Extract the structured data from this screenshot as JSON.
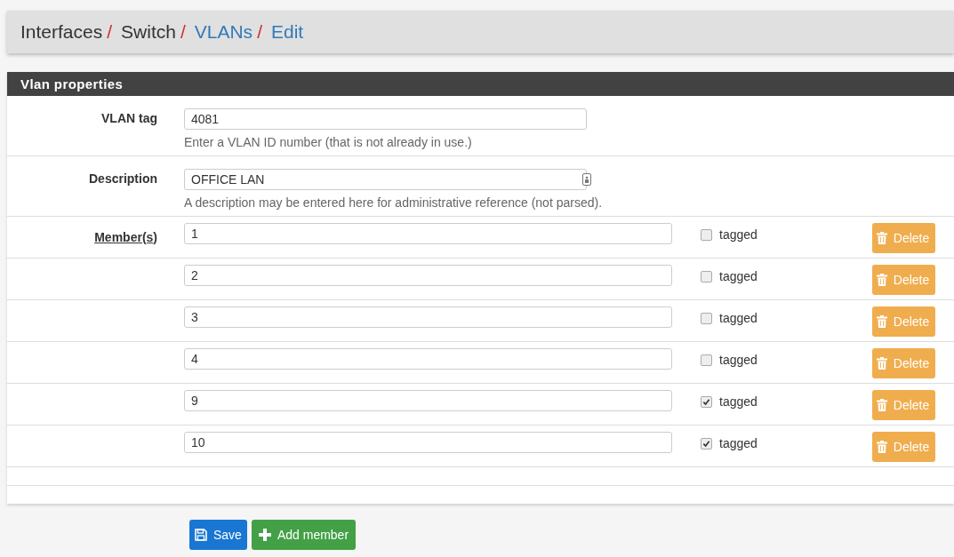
{
  "breadcrumb": [
    {
      "label": "Interfaces",
      "link": false,
      "separator": "/"
    },
    {
      "label": "Switch",
      "link": false,
      "separator": "/"
    },
    {
      "label": "VLANs",
      "link": true,
      "separator": "/"
    },
    {
      "label": "Edit",
      "link": true
    }
  ],
  "panel": {
    "title": "Vlan properties",
    "vlan_tag": {
      "label": "VLAN tag",
      "value": "4081",
      "help": "Enter a VLAN ID number (that is not already in use.)"
    },
    "description": {
      "label": "Description",
      "value": "OFFICE LAN",
      "help": "A description may be entered here for administrative reference (not parsed)."
    },
    "members_label": "Member(s)",
    "members": [
      {
        "value": "1",
        "tagged": false,
        "tagged_label": "tagged",
        "delete": "Delete"
      },
      {
        "value": "2",
        "tagged": false,
        "tagged_label": "tagged",
        "delete": "Delete"
      },
      {
        "value": "3",
        "tagged": false,
        "tagged_label": "tagged",
        "delete": "Delete"
      },
      {
        "value": "4",
        "tagged": false,
        "tagged_label": "tagged",
        "delete": "Delete"
      },
      {
        "value": "9",
        "tagged": true,
        "tagged_label": "tagged",
        "delete": "Delete"
      },
      {
        "value": "10",
        "tagged": true,
        "tagged_label": "tagged",
        "delete": "Delete"
      }
    ]
  },
  "buttons": {
    "save": "Save",
    "add_member": "Add member"
  }
}
